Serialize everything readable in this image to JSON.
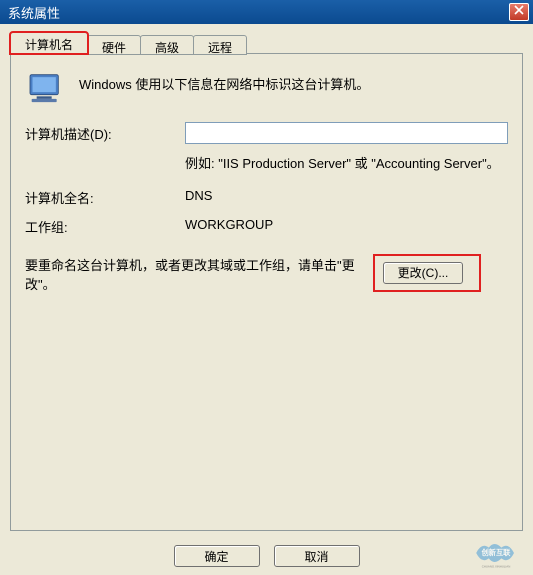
{
  "window": {
    "title": "系统属性"
  },
  "tabs": {
    "items": [
      {
        "label": "计算机名",
        "active": true,
        "highlight": true
      },
      {
        "label": "硬件",
        "active": false,
        "highlight": false
      },
      {
        "label": "高级",
        "active": false,
        "highlight": false
      },
      {
        "label": "远程",
        "active": false,
        "highlight": false
      }
    ]
  },
  "intro": "Windows 使用以下信息在网络中标识这台计算机。",
  "description": {
    "label": "计算机描述(D):",
    "value": "",
    "example": "例如: \"IIS Production Server\" 或 \"Accounting Server\"。"
  },
  "fullname": {
    "label": "计算机全名:",
    "value": "DNS"
  },
  "workgroup": {
    "label": "工作组:",
    "value": "WORKGROUP"
  },
  "change": {
    "text": "要重命名这台计算机，或者更改其域或工作组，请单击\"更改\"。",
    "button": "更改(C)..."
  },
  "buttons": {
    "ok": "确定",
    "cancel": "取消"
  },
  "watermark": {
    "brand_top": "创新互联",
    "brand_sub": "CHUANG.XINHULIAN"
  }
}
